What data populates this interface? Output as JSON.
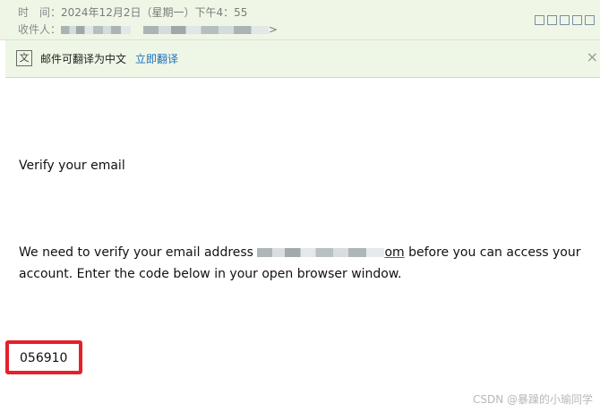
{
  "header": {
    "time_label": "时　间：",
    "time_value": "2024年12月2日（星期一）下午4：55",
    "to_label": "收件人：",
    "to_tail": ">"
  },
  "translate_bar": {
    "text": "邮件可翻译为中文",
    "link": "立即翻译",
    "close": "×"
  },
  "email": {
    "heading": "Verify your email",
    "para_before": "We need to verify your email address ",
    "email_tail": "om",
    "para_after": " before you can access your account. Enter the code below in your open browser window.",
    "code": "056910"
  },
  "watermark": "CSDN @暴躁的小瑜同学"
}
